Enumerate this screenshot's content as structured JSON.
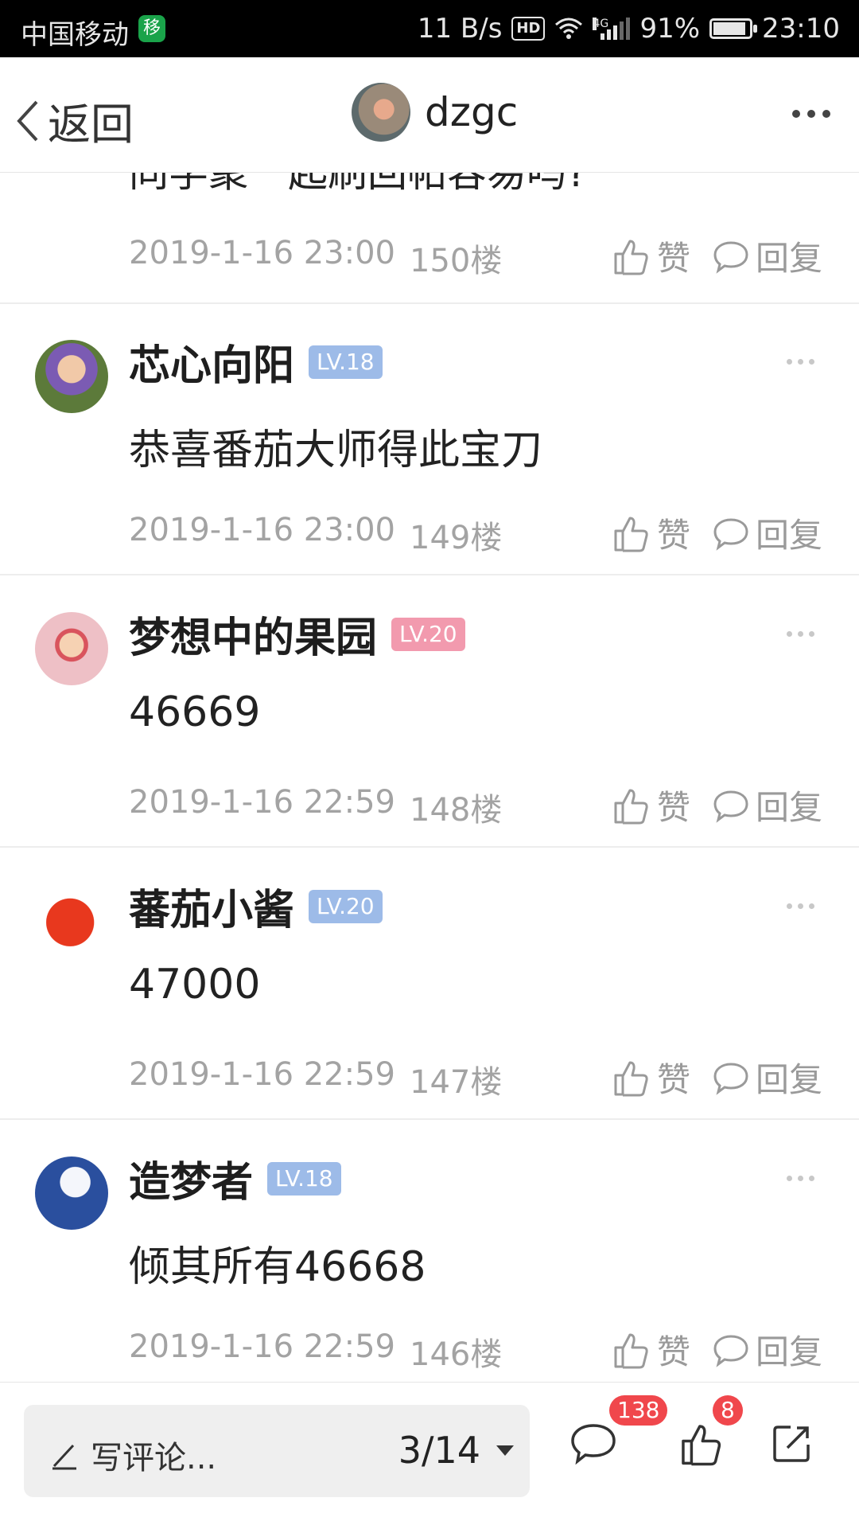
{
  "status_bar": {
    "carrier": "中国移动",
    "carrier_badge": "移",
    "speed": "11 B/s",
    "hd": "HD",
    "network": "4G",
    "battery": "91%",
    "battery_level": 0.91,
    "time": "23:10"
  },
  "navbar": {
    "back_label": "返回",
    "title": "dzgc"
  },
  "partial_post": {
    "text": "同学聚一起刷回帖容易吗?",
    "time": "2019-1-16 23:00",
    "floor": "150楼"
  },
  "actions": {
    "like_label": "赞",
    "reply_label": "回复"
  },
  "posts": [
    {
      "user": "芯心向阳",
      "level": "LV.18",
      "level_color": "#9dbbe8",
      "content": "恭喜番茄大师得此宝刀",
      "time": "2019-1-16 23:00",
      "floor": "149楼"
    },
    {
      "user": "梦想中的果园",
      "level": "LV.20",
      "level_color": "#f29aae",
      "content": "46669",
      "time": "2019-1-16 22:59",
      "floor": "148楼"
    },
    {
      "user": "蕃茄小酱",
      "level": "LV.20",
      "level_color": "#9dbbe8",
      "content": "47000",
      "time": "2019-1-16 22:59",
      "floor": "147楼"
    },
    {
      "user": "造梦者",
      "level": "LV.18",
      "level_color": "#9dbbe8",
      "content": "倾其所有46668",
      "time": "2019-1-16 22:59",
      "floor": "146楼"
    }
  ],
  "bottom_bar": {
    "write_label": "写评论...",
    "page_indicator": "3/14",
    "comment_count": "138",
    "like_count": "8"
  },
  "icons": [
    "back-chevron-icon",
    "more-icon",
    "thumbs-up-icon",
    "speech-bubble-icon",
    "pencil-icon",
    "dropdown-caret-icon",
    "share-icon"
  ]
}
